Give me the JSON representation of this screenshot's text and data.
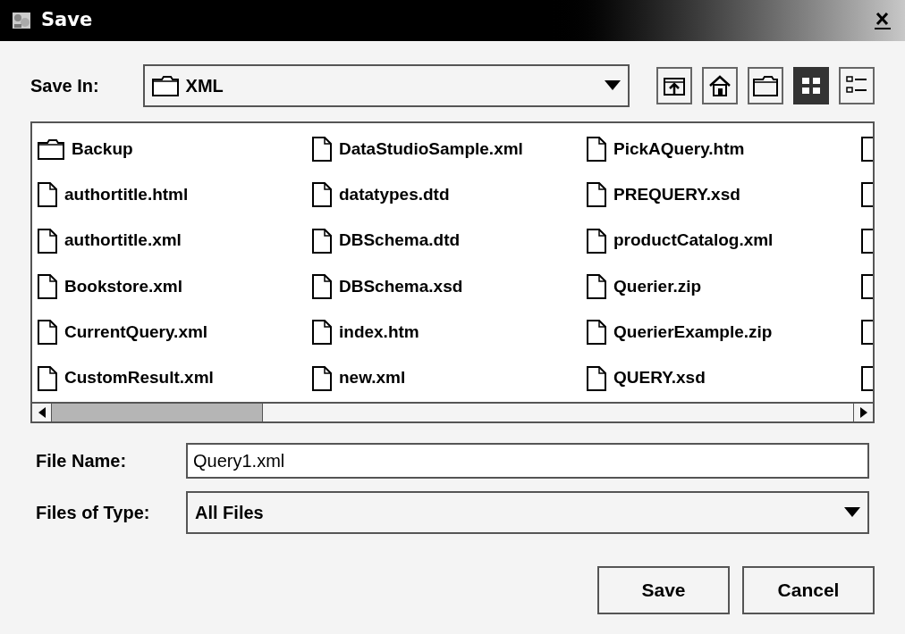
{
  "window": {
    "title": "Save"
  },
  "save_in": {
    "label": "Save In:",
    "value": "XML"
  },
  "toolbar": [
    {
      "kind": "up"
    },
    {
      "kind": "home"
    },
    {
      "kind": "new_folder"
    },
    {
      "kind": "list",
      "selected": true
    },
    {
      "kind": "details",
      "selected": false
    }
  ],
  "files": [
    {
      "name": "Backup",
      "kind": "folder"
    },
    {
      "name": "authortitle.html",
      "kind": "file"
    },
    {
      "name": "authortitle.xml",
      "kind": "file"
    },
    {
      "name": "Bookstore.xml",
      "kind": "file"
    },
    {
      "name": "CurrentQuery.xml",
      "kind": "file"
    },
    {
      "name": "CustomResult.xml",
      "kind": "file"
    },
    {
      "name": "DataStudioSample.xml",
      "kind": "file"
    },
    {
      "name": "datatypes.dtd",
      "kind": "file"
    },
    {
      "name": "DBSchema.dtd",
      "kind": "file"
    },
    {
      "name": "DBSchema.xsd",
      "kind": "file"
    },
    {
      "name": "index.htm",
      "kind": "file"
    },
    {
      "name": "new.xml",
      "kind": "file"
    },
    {
      "name": "PickAQuery.htm",
      "kind": "file"
    },
    {
      "name": "PREQUERY.xsd",
      "kind": "file"
    },
    {
      "name": "productCatalog.xml",
      "kind": "file"
    },
    {
      "name": "Querier.zip",
      "kind": "file"
    },
    {
      "name": "QuerierExample.zip",
      "kind": "file"
    },
    {
      "name": "QUERY.xsd",
      "kind": "file"
    },
    {
      "kind": "file"
    },
    {
      "kind": "file"
    },
    {
      "kind": "file"
    },
    {
      "kind": "file"
    },
    {
      "kind": "file"
    },
    {
      "kind": "file"
    }
  ],
  "file_name": {
    "label": "File Name:",
    "value": "Query1.xml"
  },
  "file_type": {
    "label": "Files of Type:",
    "value": "All Files"
  },
  "buttons": [
    "Save",
    "Cancel"
  ]
}
